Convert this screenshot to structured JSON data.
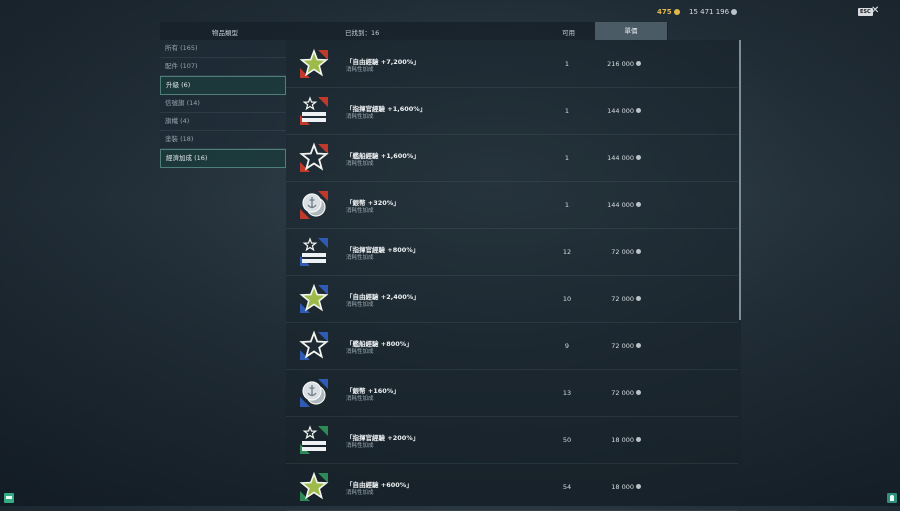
{
  "currency": {
    "gold": "475",
    "credits": "15 471 196"
  },
  "top": {
    "esc": "ESC",
    "close": "✕"
  },
  "header": {
    "item_type": "物品類型",
    "found_label": "已找到：16",
    "available": "可用",
    "price": "單價"
  },
  "categories": [
    {
      "label": "所有 (165)",
      "active": false
    },
    {
      "label": "配件 (107)",
      "active": false
    },
    {
      "label": "升級 (6)",
      "active": true
    },
    {
      "label": "信號旗 (14)",
      "active": false
    },
    {
      "label": "旗幟 (4)",
      "active": false
    },
    {
      "label": "塗裝 (18)",
      "active": false
    },
    {
      "label": "經濟加成 (16)",
      "active": true
    }
  ],
  "items": [
    {
      "name": "「自由經驗 +7,200%」",
      "desc": "消耗性加成",
      "available": "1",
      "price": "216 000",
      "icon": "free-xp-star-icon",
      "color": "#c0392b"
    },
    {
      "name": "「指揮官經驗 +1,600%」",
      "desc": "消耗性加成",
      "available": "1",
      "price": "144 000",
      "icon": "commander-xp-icon",
      "color": "#c0392b"
    },
    {
      "name": "「艦船經驗 +1,600%」",
      "desc": "消耗性加成",
      "available": "1",
      "price": "144 000",
      "icon": "ship-xp-star-icon",
      "color": "#c0392b"
    },
    {
      "name": "「銀幣 +320%」",
      "desc": "消耗性加成",
      "available": "1",
      "price": "144 000",
      "icon": "credits-coin-icon",
      "color": "#c0392b"
    },
    {
      "name": "「指揮官經驗 +800%」",
      "desc": "消耗性加成",
      "available": "12",
      "price": "72 000",
      "icon": "commander-xp-icon",
      "color": "#2f5bb5"
    },
    {
      "name": "「自由經驗 +2,400%」",
      "desc": "消耗性加成",
      "available": "10",
      "price": "72 000",
      "icon": "free-xp-star-icon",
      "color": "#2f5bb5"
    },
    {
      "name": "「艦船經驗 +800%」",
      "desc": "消耗性加成",
      "available": "9",
      "price": "72 000",
      "icon": "ship-xp-star-icon",
      "color": "#2f5bb5"
    },
    {
      "name": "「銀幣 +160%」",
      "desc": "消耗性加成",
      "available": "13",
      "price": "72 000",
      "icon": "credits-coin-icon",
      "color": "#2f5bb5"
    },
    {
      "name": "「指揮官經驗 +200%」",
      "desc": "消耗性加成",
      "available": "50",
      "price": "18 000",
      "icon": "commander-xp-icon",
      "color": "#2e8b57"
    },
    {
      "name": "「自由經驗 +600%」",
      "desc": "消耗性加成",
      "available": "54",
      "price": "18 000",
      "icon": "free-xp-star-icon",
      "color": "#2e8b57"
    }
  ]
}
